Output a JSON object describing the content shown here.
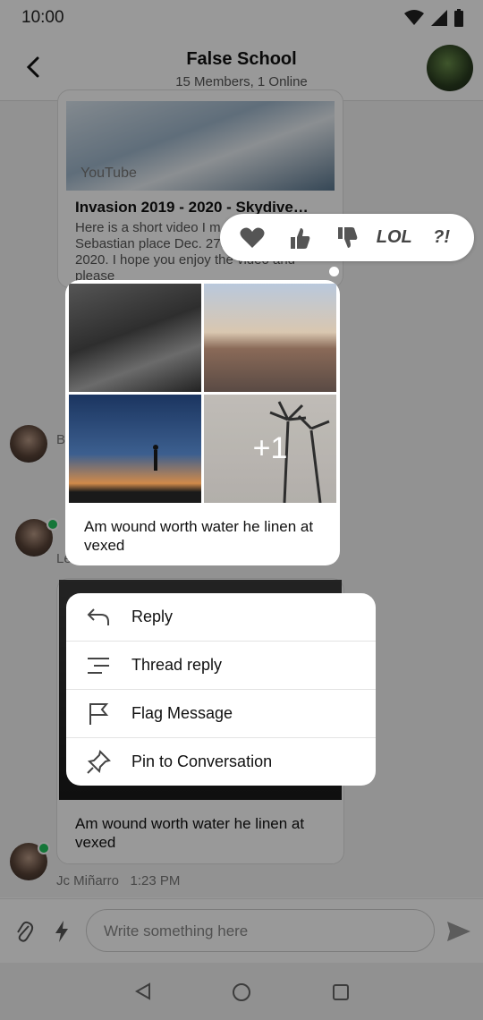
{
  "status_bar": {
    "time": "10:00"
  },
  "header": {
    "title": "False School",
    "subtitle": "15 Members, 1 Online"
  },
  "youtube_card": {
    "label": "YouTube",
    "title": "Invasion 2019 - 2020 - Skydive…",
    "description": "Here is a short video I m the event in Sebastian place Dec. 27th 2019 - Jan 1st 2020. I hope you enjoy the video and please"
  },
  "highlighted_message": {
    "more_count": "+1",
    "text": "Am wound worth water he linen at vexed"
  },
  "bottom_message": {
    "text": "Am wound worth water he linen at vexed",
    "sender": "Jc Miñarro",
    "time": "1:23 PM"
  },
  "partial_senders": {
    "first": "B",
    "second": "Le"
  },
  "reactions": [
    {
      "icon": "heart-icon"
    },
    {
      "icon": "thumbs-up-icon"
    },
    {
      "icon": "thumbs-down-icon"
    },
    {
      "icon": "lol-icon",
      "text": "LOL"
    },
    {
      "icon": "interrobang-icon",
      "text": "?!"
    }
  ],
  "menu": {
    "reply": "Reply",
    "thread_reply": "Thread reply",
    "flag": "Flag Message",
    "pin": "Pin to Conversation"
  },
  "composer": {
    "placeholder": "Write something here"
  },
  "colors": {
    "online": "#22c55e",
    "overlay": "rgba(0,0,0,0.40)"
  }
}
